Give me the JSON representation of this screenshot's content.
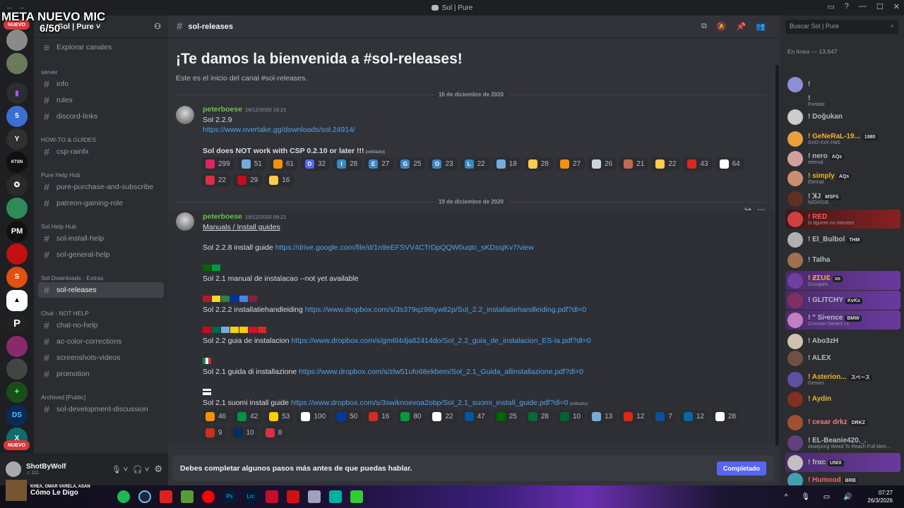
{
  "window": {
    "title": "Sol | Pure"
  },
  "overlay": {
    "line1": "META NUEVO MIC",
    "line2": "6/50"
  },
  "guilds": {
    "badge_top": "NUEVO",
    "badge_bottom": "NUEVO"
  },
  "server": {
    "name": "Sol | Pure",
    "explore": "Explorar canales"
  },
  "categories": [
    {
      "name": "server",
      "channels": [
        "info",
        "rules",
        "discord-links"
      ]
    },
    {
      "name": "HOW-TO & GUIDES",
      "channels": [
        "csp-rainfx"
      ]
    },
    {
      "name": "Pure Help Hub",
      "channels": [
        "pure-purchase-and-subscribe",
        "patreon-gaining-role"
      ]
    },
    {
      "name": "Sol Help Hub",
      "channels": [
        "sol-install-help",
        "sol-general-help"
      ]
    },
    {
      "name": "Sol Downloads - Extras",
      "channels": [
        "sol-releases"
      ]
    },
    {
      "name": "Chat - NOT HELP",
      "channels": [
        "chat-no-help",
        "ac-color-corrections",
        "screenshots-videos",
        "promotion"
      ]
    },
    {
      "name": "Archived [Public]",
      "channels": [
        "sol-development-discussion"
      ]
    }
  ],
  "user": {
    "name": "ShotByWolf",
    "status": "♫ 111",
    "song_artist": "KHEA, OMAR VARELA, ASAN",
    "song_title": "Cómo Le Digo"
  },
  "channel": {
    "name": "sol-releases",
    "welcome": "¡Te damos la bienvenida a #sol-releases!",
    "welcome_sub": "Este es el inicio del canal #sol-releases."
  },
  "search": {
    "placeholder": "Buscar Sol | Pure"
  },
  "date1": "16 de diciembre de 2020",
  "date2": "19 de diciembre de 2020",
  "msg1": {
    "author": "peterboese",
    "time": "16/12/2020 16:21",
    "l1": "Sol 2.2.9",
    "l2": "https://www.overtake.gg/downloads/sol.24914/",
    "l3": "Sol does NOT work with CSP 0.2.10 or later !!!",
    "edited": "(editado)",
    "reactions": [
      {
        "color": "#e0245e",
        "n": "299"
      },
      {
        "color": "#74acdf",
        "n": "51"
      },
      {
        "color": "#f4900c",
        "n": "61"
      },
      {
        "color": "#5865f2",
        "n": "32",
        "l": "D"
      },
      {
        "color": "#3b88c3",
        "n": "28",
        "l": "I"
      },
      {
        "color": "#3b88c3",
        "n": "27",
        "l": "E"
      },
      {
        "color": "#3b88c3",
        "n": "25",
        "l": "G"
      },
      {
        "color": "#3b88c3",
        "n": "23",
        "l": "O"
      },
      {
        "color": "#3b88c3",
        "n": "22",
        "l": "L"
      },
      {
        "color": "#74acdf",
        "n": "18"
      },
      {
        "color": "#ffcc4d",
        "n": "28"
      },
      {
        "color": "#f4900c",
        "n": "27"
      },
      {
        "color": "#ccd6dd",
        "n": "26"
      },
      {
        "color": "#c1694f",
        "n": "21"
      },
      {
        "color": "#ffcc4d",
        "n": "22"
      },
      {
        "color": "#d52b1e",
        "n": "43"
      },
      {
        "color": "#ffffff",
        "n": "64"
      },
      {
        "color": "#dd2e44",
        "n": "22"
      },
      {
        "color": "#c60b1e",
        "n": "29"
      },
      {
        "color": "#ffcc4d",
        "n": "16"
      }
    ]
  },
  "msg2": {
    "author": "peterboese",
    "time": "19/12/2020 08:21",
    "title": "Manuals / Install guides",
    "g1": "Sol 2.2.8 install guide",
    "u1": "https://drive.google.com/file/d/1n9eEFSVV4CTrDpQQW0uqtc_sKDssjKv7/view",
    "g2": "Sol 2.1 manual de instalacao --not yet available",
    "g3": "Sol 2.2.2 installatiehandleiding",
    "u3": "https://www.dropbox.com/s/3s379qz98tyw82p/Sol_2.2_installatiehandleiding.pdf?dl=0",
    "g4": "Sol 2.2 guia de instalacion",
    "u4": "https://www.dropbox.com/s/gm6l4dja82414do/Sol_2.2_guia_de_instalacion_ES-la.pdf?dl=0",
    "g5": "Sol 2.1 guida di installazione",
    "u5": "https://www.dropbox.com/s/zlw51ufo68ekbem/Sol_2.1_Guida_allinstallazione.pdf?dl=0",
    "g6": "Sol 2.1 suomi install guide",
    "u6": "https://www.dropbox.com/s/3swiknoevoa2obp/Sol_2.1_suomi_install_guide.pdf?dl=0",
    "edited": "(editado)",
    "reactions": [
      {
        "color": "#f4900c",
        "n": "46"
      },
      {
        "color": "#009246",
        "n": "42"
      },
      {
        "color": "#ffce00",
        "n": "53"
      },
      {
        "color": "#ffffff",
        "n": "100"
      },
      {
        "color": "#0039a6",
        "n": "50"
      },
      {
        "color": "#d52b1e",
        "n": "16"
      },
      {
        "color": "#009c3b",
        "n": "80"
      },
      {
        "color": "#ffffff",
        "n": "22"
      },
      {
        "color": "#0055a4",
        "n": "47"
      },
      {
        "color": "#006600",
        "n": "25"
      },
      {
        "color": "#006c35",
        "n": "28"
      },
      {
        "color": "#006233",
        "n": "10"
      },
      {
        "color": "#74acdf",
        "n": "13"
      },
      {
        "color": "#de2910",
        "n": "12"
      },
      {
        "color": "#0b4ea2",
        "n": "7"
      },
      {
        "color": "#006aa7",
        "n": "12"
      },
      {
        "color": "#ffffff",
        "n": "28"
      },
      {
        "color": "#d52b1e",
        "n": "9"
      },
      {
        "color": "#002d62",
        "n": "10"
      },
      {
        "color": "#dd2e44",
        "n": "8"
      }
    ]
  },
  "composer": {
    "text": "Debes completar algunos pasos más antes de que puedas hablar.",
    "button": "Completado"
  },
  "members": {
    "header": "En línea — 13,647",
    "list": [
      {
        "name": "!",
        "status": "",
        "color": "#b5bac1",
        "av": "#8b8fd6"
      },
      {
        "name": "!",
        "status": "Fortnite",
        "color": "#b5bac1",
        "av": "#2b2d31"
      },
      {
        "name": "! Doğukan",
        "status": "",
        "color": "#b5bac1",
        "av": "#cccccc"
      },
      {
        "name": "! GeNeRaL-19...",
        "status": "GnO-XxX-HaS",
        "tag": "1980",
        "color": "#f0b232",
        "av": "#e8a040"
      },
      {
        "name": "! nero",
        "status": "eternal.",
        "tag": "AQs",
        "color": "#b5bac1",
        "av": "#d0a0a0"
      },
      {
        "name": "! simply",
        "status": "Eternal",
        "tag": "AQs",
        "color": "#f0b232",
        "av": "#c89070"
      },
      {
        "name": "! ꓘJ",
        "status": "N/O/I/S/E",
        "tag": "MSFS",
        "color": "#b5bac1",
        "av": "#603020"
      },
      {
        "name": "! RED",
        "status": "lo tiguere no mienten",
        "color": "#ff5555",
        "av": "#d04040"
      },
      {
        "name": "! El_Bulbol",
        "status": "",
        "tag": "THM",
        "color": "#b5bac1",
        "av": "#b0b0b0"
      },
      {
        "name": "! Talha",
        "status": "",
        "color": "#b5bac1",
        "av": "#a07050"
      },
      {
        "name": "! ƵΣUƐ",
        "status": "Groupies",
        "tag": "xo",
        "color": "#f0b232",
        "av": "#7040a0"
      },
      {
        "name": "! GLITCHY",
        "status": "",
        "tag": "KvKs",
        "color": "#b5bac1",
        "av": "#803060"
      },
      {
        "name": "! \" Si•ence",
        "status": "Crimson Desert +1",
        "tag": "BMW",
        "color": "#b5bac1",
        "av": "#c080c0"
      },
      {
        "name": "! Abo3zH",
        "status": "",
        "color": "#b5bac1",
        "av": "#d0c0b0"
      },
      {
        "name": "! ALEX",
        "status": "",
        "color": "#b5bac1",
        "av": "#705040"
      },
      {
        "name": "! Asterion...",
        "status": "Gemini",
        "tag": "スペース",
        "color": "#f0b232",
        "av": "#6050a0"
      },
      {
        "name": "! Aydin",
        "status": "",
        "color": "#f0b232",
        "av": "#803020"
      },
      {
        "name": "! cesar drkz",
        "status": "",
        "tag": "DRKZ",
        "color": "#ff7a7a",
        "av": "#a05030"
      },
      {
        "name": "! EL-Beanie420._.",
        "status": "Analyzing Weed To Reach Full Men...",
        "color": "#b5bac1",
        "av": "#604080"
      },
      {
        "name": "! frαc",
        "status": "",
        "tag": "UNIX",
        "color": "#b5bac1",
        "av": "#c0c0c0"
      },
      {
        "name": "! Humood",
        "status": "",
        "tag": "BRB",
        "color": "#ff6060",
        "av": "#40a0b0"
      }
    ]
  },
  "clock": {
    "time": "07:27",
    "date": "26/3/2026"
  }
}
